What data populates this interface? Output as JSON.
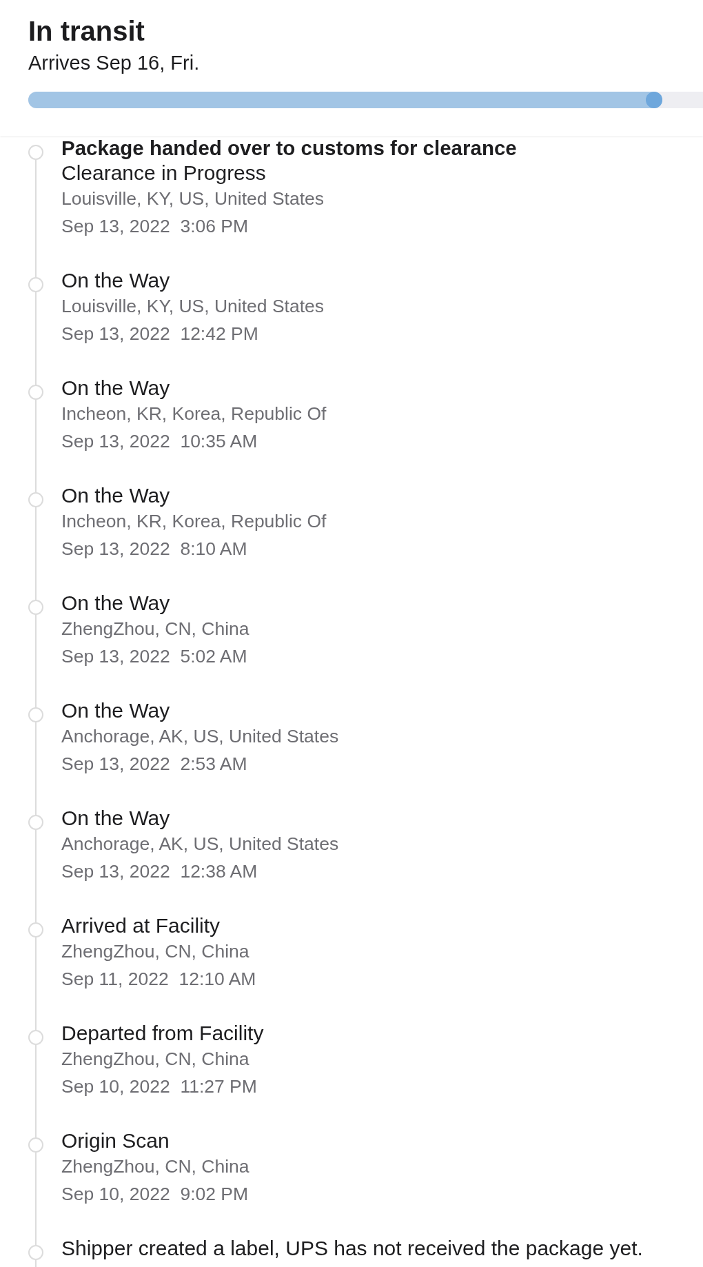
{
  "header": {
    "status": "In transit",
    "eta": "Arrives Sep 16, Fri.",
    "progress": {
      "level": 0.94
    }
  },
  "events": [
    {
      "title": "Package handed over to customs for clearance",
      "latest": true,
      "detail": "Clearance in Progress",
      "location": "Louisville, KY, US, United States",
      "time": "Sep 13, 2022  3:06 PM"
    },
    {
      "title": "On the Way",
      "latest": false,
      "location": "Louisville, KY, US, United States",
      "time": "Sep 13, 2022  12:42 PM"
    },
    {
      "title": "On the Way",
      "latest": false,
      "location": "Incheon, KR, Korea, Republic Of",
      "time": "Sep 13, 2022  10:35 AM"
    },
    {
      "title": "On the Way",
      "latest": false,
      "location": "Incheon, KR, Korea, Republic Of",
      "time": "Sep 13, 2022  8:10 AM"
    },
    {
      "title": "On the Way",
      "latest": false,
      "location": "ZhengZhou, CN, China",
      "time": "Sep 13, 2022  5:02 AM"
    },
    {
      "title": "On the Way",
      "latest": false,
      "location": "Anchorage, AK, US, United States",
      "time": "Sep 13, 2022  2:53 AM"
    },
    {
      "title": "On the Way",
      "latest": false,
      "location": "Anchorage, AK, US, United States",
      "time": "Sep 13, 2022  12:38 AM"
    },
    {
      "title": "Arrived at Facility",
      "latest": false,
      "location": "ZhengZhou, CN, China",
      "time": "Sep 11, 2022  12:10 AM"
    },
    {
      "title": "Departed from Facility",
      "latest": false,
      "location": "ZhengZhou, CN, China",
      "time": "Sep 10, 2022  11:27 PM"
    },
    {
      "title": "Origin Scan",
      "latest": false,
      "location": "ZhengZhou, CN, China",
      "time": "Sep 10, 2022  9:02 PM"
    },
    {
      "title": "Shipper created a label, UPS has not received the package yet.",
      "latest": false
    }
  ]
}
